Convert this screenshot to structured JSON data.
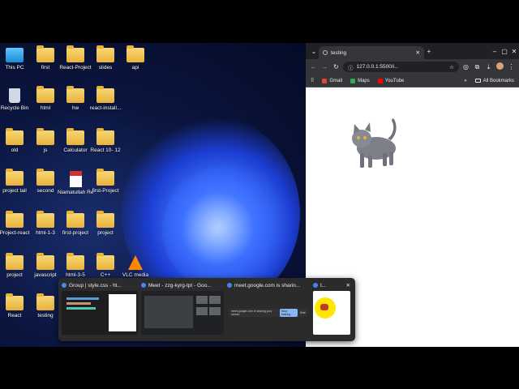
{
  "desktop": {
    "icons": [
      {
        "label": "This PC",
        "icon": "monitor-icon"
      },
      {
        "label": "first",
        "icon": "folder-icon"
      },
      {
        "label": "React-Project",
        "icon": "folder-icon"
      },
      {
        "label": "slides",
        "icon": "folder-icon"
      },
      {
        "label": "api",
        "icon": "folder-icon"
      },
      {
        "label": "Recycle Bin",
        "icon": "recycle-bin-icon"
      },
      {
        "label": "html",
        "icon": "folder-icon"
      },
      {
        "label": "hw",
        "icon": "folder-icon"
      },
      {
        "label": "react-install...",
        "icon": "folder-icon"
      },
      {
        "label": "old",
        "icon": "folder-icon"
      },
      {
        "label": "js",
        "icon": "folder-icon"
      },
      {
        "label": "Calculator",
        "icon": "folder-icon"
      },
      {
        "label": "React 10- 12",
        "icon": "folder-icon"
      },
      {
        "label": "project tail",
        "icon": "folder-icon"
      },
      {
        "label": "second",
        "icon": "folder-icon"
      },
      {
        "label": "Niamatullah Rezaie.pdf",
        "icon": "pdf-icon"
      },
      {
        "label": "first-Project",
        "icon": "folder-icon"
      },
      {
        "label": "Project-react",
        "icon": "folder-icon"
      },
      {
        "label": "html-1-3",
        "icon": "folder-icon"
      },
      {
        "label": "first-project",
        "icon": "folder-icon"
      },
      {
        "label": "project",
        "icon": "folder-icon"
      },
      {
        "label": "project",
        "icon": "folder-icon"
      },
      {
        "label": "javascript",
        "icon": "folder-icon"
      },
      {
        "label": "html-3-5",
        "icon": "folder-icon"
      },
      {
        "label": "C++",
        "icon": "folder-icon"
      },
      {
        "label": "VLC media",
        "icon": "vlc-icon"
      },
      {
        "label": "React",
        "icon": "folder-icon"
      },
      {
        "label": "testing",
        "icon": "folder-icon"
      }
    ]
  },
  "browser": {
    "tab_title": "testing",
    "url": "127.0.0.1:5500/i...",
    "bookmarks": [
      {
        "label": "Gmail",
        "color": "#ea4335"
      },
      {
        "label": "Maps",
        "color": "#34a853"
      },
      {
        "label": "YouTube",
        "color": "#ff0000"
      }
    ],
    "all_bookmarks": "All Bookmarks"
  },
  "switcher": {
    "items": [
      {
        "caption": "Group | style.css - ht...",
        "color": "#3b8eea"
      },
      {
        "caption": "Meet - zzg-kyrg-tpt - Goo...",
        "color": "#4285f4"
      },
      {
        "caption": "meet.google.com is sharin...",
        "color": "#4285f4"
      },
      {
        "caption": "t...",
        "color": "#4285f4"
      }
    ],
    "share_text": "meet.google.com is sharing your screen",
    "stop_label": "Stop sharing",
    "hide_label": "Hide"
  }
}
